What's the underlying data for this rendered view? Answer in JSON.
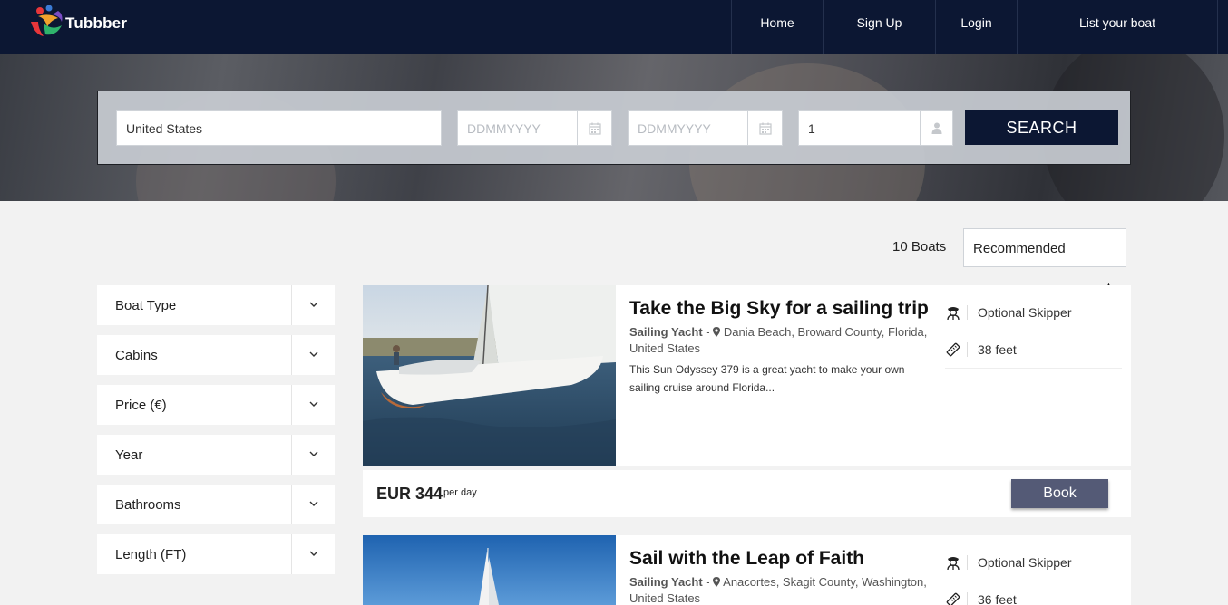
{
  "header": {
    "logo_text": "Tubbber",
    "nav": [
      "Home",
      "Sign Up",
      "Login",
      "List your boat"
    ]
  },
  "search": {
    "location_value": "United States",
    "date_from_placeholder": "DDMMYYYY",
    "date_to_placeholder": "DDMMYYYY",
    "guests_value": "1",
    "button_label": "SEARCH"
  },
  "results": {
    "count_label": "10 Boats",
    "sort_value": "Recommended"
  },
  "filters": [
    "Boat Type",
    "Cabins",
    "Price (€)",
    "Year",
    "Bathrooms",
    "Length (FT)"
  ],
  "boats": [
    {
      "title": "Take the Big Sky for a sailing trip",
      "type": "Sailing Yacht",
      "location": "Dania Beach, Broward County, Florida, United States",
      "description": "This Sun Odyssey 379 is a great yacht to make your own sailing cruise around Florida...",
      "skipper": "Optional Skipper",
      "length": "38 feet",
      "price": "EUR 344",
      "price_unit": "per day",
      "book_label": "Book"
    },
    {
      "title": "Sail with the Leap of Faith",
      "type": "Sailing Yacht",
      "location": "Anacortes, Skagit County, Washington, United States",
      "skipper": "Optional Skipper",
      "length": "36 feet"
    }
  ],
  "colors": {
    "navy": "#0c1733",
    "book_button": "#545a76"
  }
}
